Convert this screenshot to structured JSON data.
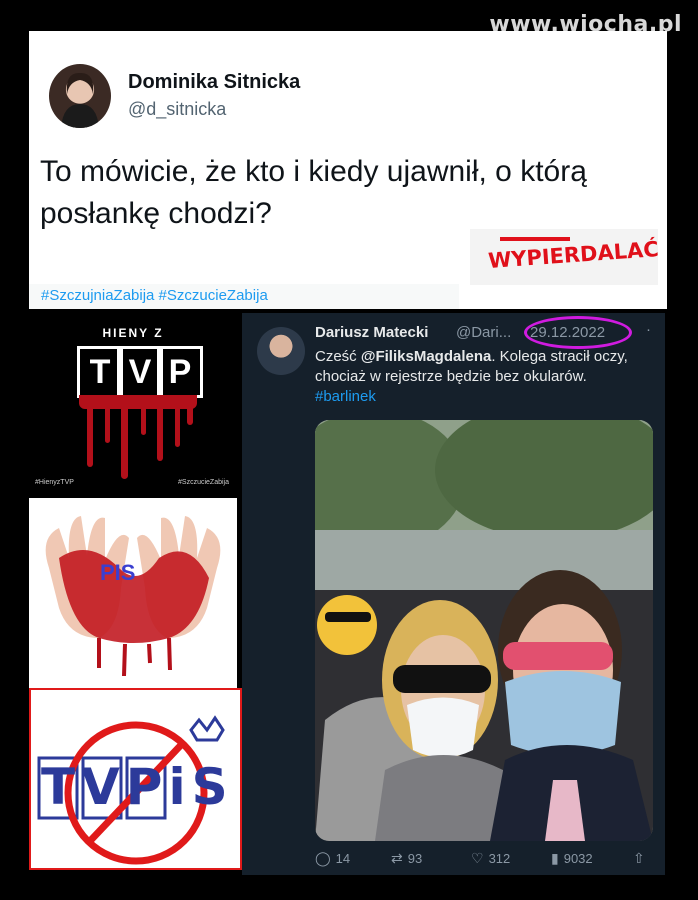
{
  "watermark": "www.wiocha.pl",
  "tweet_main": {
    "name": "Dominika Sitnicka",
    "handle": "@d_sitnicka",
    "text": "To mówicie, że kto i kiedy ujawnił, o którą posłankę chodzi?",
    "stamp": "WYPIERDALAĆ",
    "hashtags": "#SzczujniaZabija #SzczucieZabija"
  },
  "panels": {
    "tvp": {
      "heading": "HIENY Z",
      "letters": [
        "T",
        "V",
        "P"
      ],
      "footer_left": "#HienyzTVP",
      "footer_right": "#SzczucieZabija"
    },
    "hands": {
      "label": "PIS"
    },
    "tvpis": {
      "logo": "TVPiS"
    }
  },
  "tweet_quoted": {
    "name": "Dariusz Matecki",
    "handle": "@Dari...",
    "date": "29.12.2022",
    "more": "·",
    "text_prefix": "Cześć ",
    "mention": "@FiliksMagdalena",
    "text_body": ". Kolega stracił oczy, chociaż w rejestrze będzie bez okularów. ",
    "hashtag": "#barlinek",
    "replies": "14",
    "retweets": "93",
    "likes": "312",
    "views": "9032"
  },
  "colors": {
    "accent_blue": "#1d9bf0",
    "dark_bg": "#15202b",
    "stamp_red": "#e0101a",
    "circle_highlight": "#d01be0"
  }
}
